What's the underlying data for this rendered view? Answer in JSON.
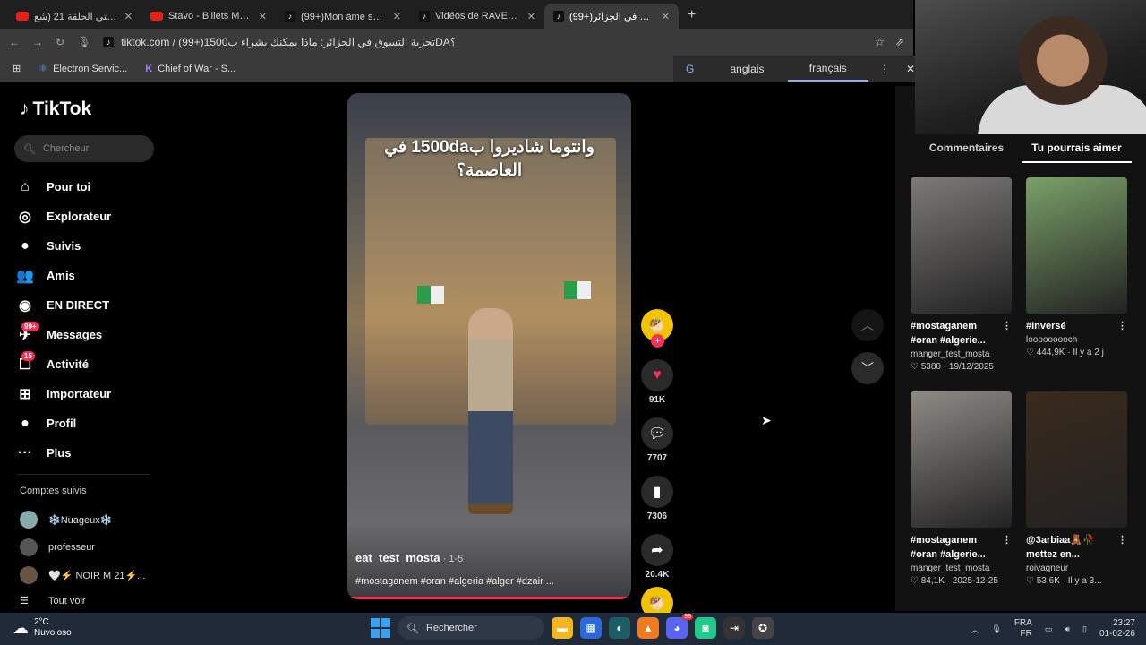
{
  "browser": {
    "tabs": [
      {
        "title": "شالا بالا سيتي الحلقة 21 (شع",
        "icon": "youtube-icon",
        "active": false
      },
      {
        "title": "Stavo - Billets Mauves feat.",
        "icon": "youtube-icon",
        "active": false
      },
      {
        "title": "(99+)Mon âme sœur 💗",
        "icon": "tiktok-icon",
        "active": false
      },
      {
        "title": "Vidéos de RAVEN (@i.raven",
        "icon": "tiktok-icon",
        "active": false
      },
      {
        "title": "(99+)تجربة التسوق في الجزائر",
        "icon": "tiktok-icon",
        "active": true
      }
    ],
    "new_tab": "+",
    "url": "tiktok.com / (99+)تجربة التسوق في الجزائر: ماذا يمكنك بشراء ب1500DA؟",
    "bookmarks": [
      "Electron Servic...",
      "Chief of War - S..."
    ],
    "translate": {
      "lang_from": "anglais",
      "lang_to": "français"
    }
  },
  "tiktok": {
    "logo": "TikTok",
    "search_placeholder": "Chercheur",
    "nav": [
      {
        "label": "Pour toi",
        "icon": "home-icon",
        "glyph": "⌂"
      },
      {
        "label": "Explorateur",
        "icon": "compass-icon",
        "glyph": "◎"
      },
      {
        "label": "Suivis",
        "icon": "following-avatar-icon",
        "glyph": "●"
      },
      {
        "label": "Amis",
        "icon": "friends-icon",
        "glyph": "👥"
      },
      {
        "label": "EN DIRECT",
        "icon": "live-icon",
        "glyph": "◉"
      },
      {
        "label": "Messages",
        "icon": "messages-icon",
        "glyph": "✈",
        "badge": "99+"
      },
      {
        "label": "Activité",
        "icon": "activity-icon",
        "glyph": "☐",
        "badge": "15"
      },
      {
        "label": "Importateur",
        "icon": "upload-icon",
        "glyph": "⊞"
      },
      {
        "label": "Profil",
        "icon": "profile-avatar-icon",
        "glyph": "●"
      },
      {
        "label": "Plus",
        "icon": "more-icon",
        "glyph": "···"
      }
    ],
    "following_title": "Comptes suivis",
    "following": [
      {
        "name": "❄️Nuageux❄️"
      },
      {
        "name": "professeur"
      },
      {
        "name": "🤍⚡ NOIR M 21⚡..."
      }
    ],
    "see_all": "Tout voir",
    "video": {
      "caption": "وانتوما شاديروا ب1500da في العاصمة؟",
      "username": "eat_test_mosta",
      "date": " · 1-5",
      "tags": "#mostaganem #oran #algeria #alger #dzair ...",
      "progress": 0.99
    },
    "actions": {
      "likes": "91K",
      "comments": "7707",
      "saves": "7306",
      "shares": "20.4K"
    },
    "right_tabs": [
      "Commentaires",
      "Tu pourrais aimer"
    ],
    "cards": [
      {
        "title": "#mostaganem #oran #algerie...",
        "user": "manger_test_mosta",
        "likes": "5380",
        "date": "19/12/2025",
        "color": "#7d7a78"
      },
      {
        "title": "#Inversé",
        "user": "looooooooch",
        "likes": "444,9K",
        "date": "Il y a 2 j",
        "color": "#7aa068"
      },
      {
        "title": "#mostaganem #oran #algerie...",
        "user": "manger_test_mosta",
        "likes": "84,1K",
        "date": "2025-12-25",
        "color": "#8e8a86"
      },
      {
        "title": "@3arbiaa🧸🥀 mettez en...",
        "user": "roivagneur",
        "likes": "53,6K",
        "date": "Il y a 3...",
        "color": "#3a2a1c"
      }
    ]
  },
  "taskbar": {
    "temp": "2°C",
    "weather": "Nuvoloso",
    "search": "Rechercher",
    "lang1": "FRA",
    "lang2": "FR",
    "time": "23:27",
    "date": "01-02-26",
    "discord_badge": "99"
  }
}
